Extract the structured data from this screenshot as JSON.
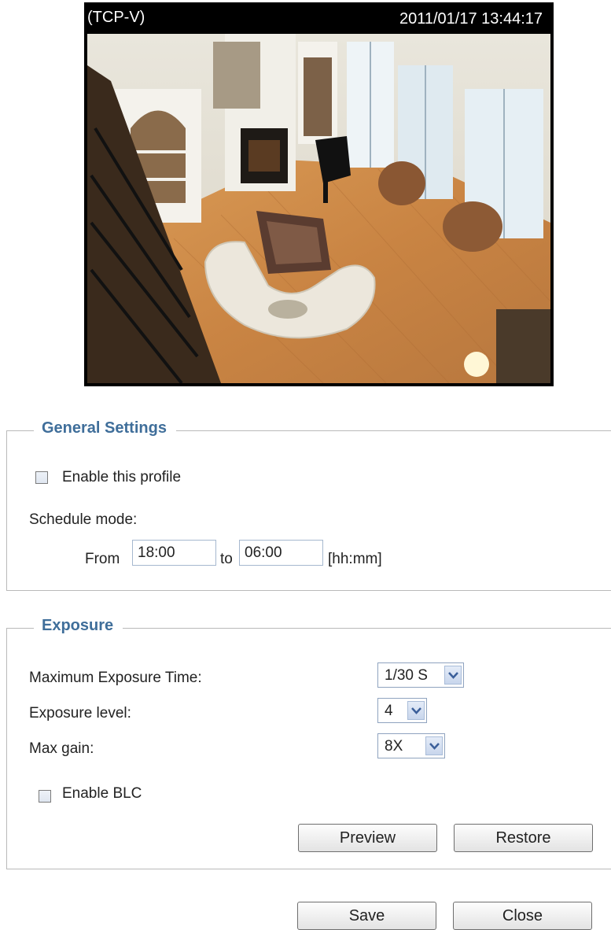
{
  "camera": {
    "label": "(TCP-V)",
    "timestamp": "2011/01/17 13:44:17"
  },
  "general": {
    "legend": "General Settings",
    "enable_profile_label": "Enable this profile",
    "enable_profile_checked": false,
    "schedule_mode_label": "Schedule mode:",
    "from_label": "From",
    "from_value": "18:00",
    "to_label": "to",
    "to_value": "06:00",
    "format_hint": "[hh:mm]"
  },
  "exposure": {
    "legend": "Exposure",
    "max_exposure_label": "Maximum Exposure Time:",
    "max_exposure_value": "1/30 S",
    "exposure_level_label": "Exposure level:",
    "exposure_level_value": "4",
    "max_gain_label": "Max gain:",
    "max_gain_value": "8X",
    "blc_label": "Enable BLC",
    "blc_checked": false,
    "preview_label": "Preview",
    "restore_label": "Restore"
  },
  "footer": {
    "save_label": "Save",
    "close_label": "Close"
  },
  "colors": {
    "legend_text": "#3f6e9a",
    "border": "#b9b9b9"
  },
  "icons": [
    "checkbox-icon",
    "chevron-down-icon"
  ]
}
